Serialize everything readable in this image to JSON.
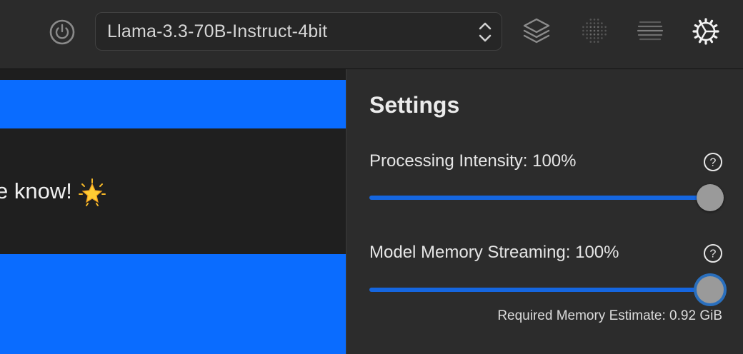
{
  "toolbar": {
    "model_select": {
      "value": "Llama-3.3-70B-Instruct-4bit"
    },
    "icons": [
      "power-icon",
      "updown-chevron-icon",
      "layers-icon",
      "dots-grid-icon",
      "lines-icon",
      "gear-icon"
    ]
  },
  "chat": {
    "message_text": "e know!",
    "emoji": "star-emoji",
    "accent_color": "#0a6cff"
  },
  "settings": {
    "title": "Settings",
    "processing": {
      "label": "Processing Intensity: 100%",
      "value": 1.0
    },
    "memory": {
      "label": "Model Memory Streaming: 100%",
      "value": 1.0
    },
    "estimate": "Required Memory Estimate: 0.92 GiB",
    "slider_color": "#1566e0"
  }
}
